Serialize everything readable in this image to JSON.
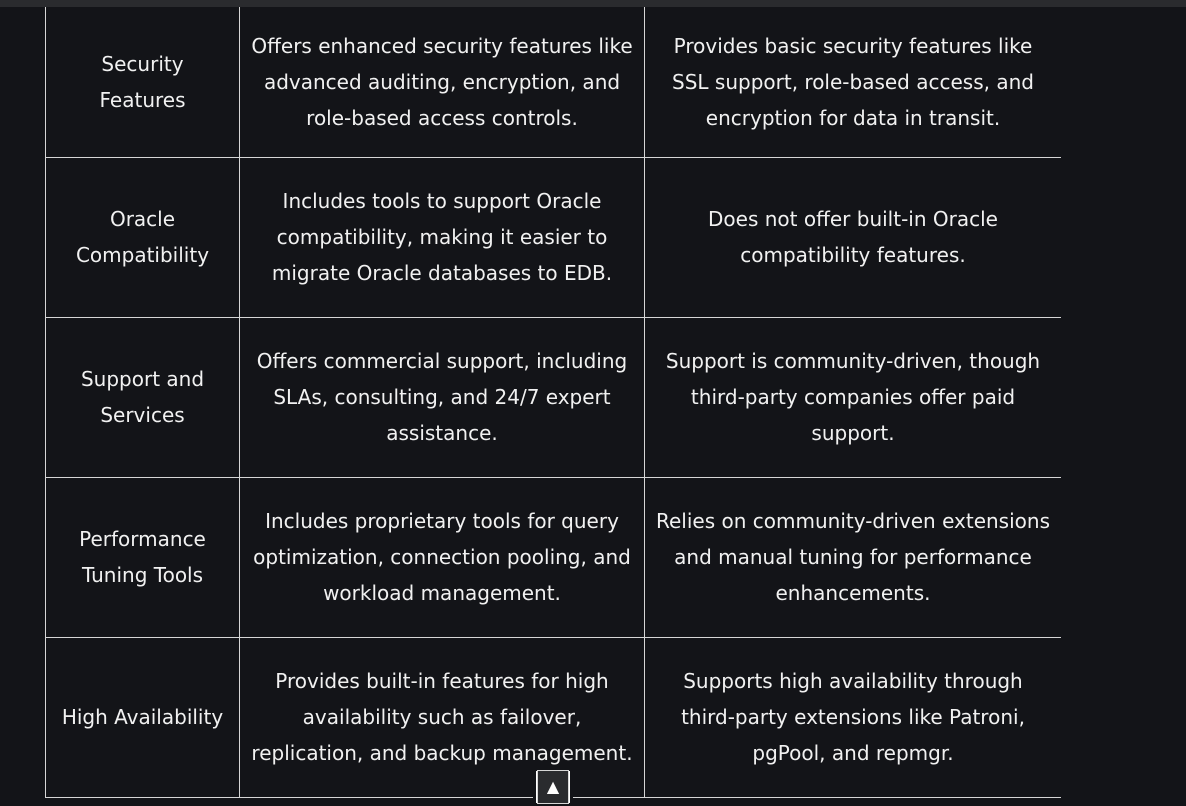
{
  "table": {
    "rows": [
      {
        "feature": "Security Features",
        "edb": "Offers enhanced security features like advanced auditing, encryption, and role-based access controls.",
        "postgres": "Provides basic security features like SSL support, role-based access, and encryption for data in transit."
      },
      {
        "feature": "Oracle Compatibility",
        "edb": "Includes tools to support Oracle compatibility, making it easier to migrate Oracle databases to EDB.",
        "postgres": "Does not offer built-in Oracle compatibility features."
      },
      {
        "feature": "Support and Services",
        "edb": "Offers commercial support, including SLAs, consulting, and 24/7 expert assistance.",
        "postgres": "Support is community-driven, though third-party companies offer paid support."
      },
      {
        "feature": "Performance Tuning Tools",
        "edb": "Includes proprietary tools for query optimization, connection pooling, and workload management.",
        "postgres": "Relies on community-driven extensions and manual tuning for performance enhancements."
      },
      {
        "feature": "High Availability",
        "edb": "Provides built-in features for high availability such as failover, replication, and backup management.",
        "postgres": "Supports high availability through third-party extensions like Patroni, pgPool, and repmgr."
      }
    ]
  },
  "scroll_top": {
    "icon": "arrow-up-icon",
    "glyph": "▲"
  },
  "colors": {
    "background": "#131418",
    "border": "#d6d6d6",
    "text": "#f1f1f1"
  }
}
